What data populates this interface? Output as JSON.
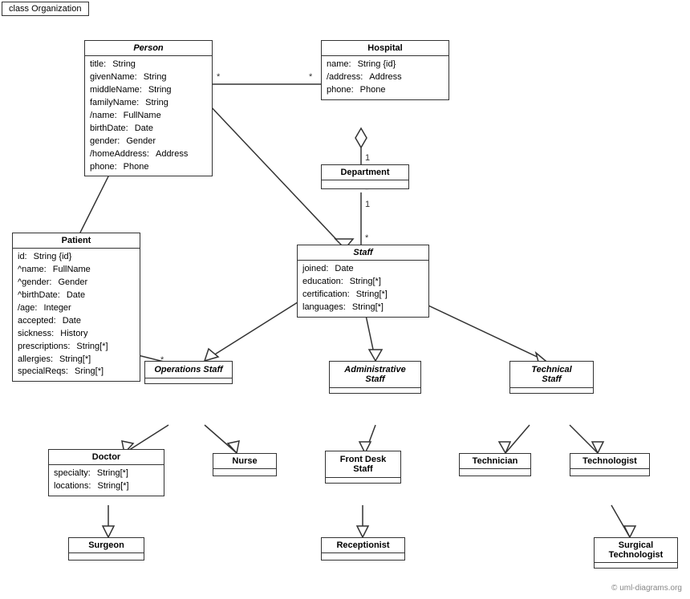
{
  "title": "class Organization",
  "watermark": "© uml-diagrams.org",
  "classes": {
    "person": {
      "name": "Person",
      "italic": true,
      "attrs": [
        {
          "name": "title:",
          "type": "String"
        },
        {
          "name": "givenName:",
          "type": "String"
        },
        {
          "name": "middleName:",
          "type": "String"
        },
        {
          "name": "familyName:",
          "type": "String"
        },
        {
          "name": "/name:",
          "type": "FullName"
        },
        {
          "name": "birthDate:",
          "type": "Date"
        },
        {
          "name": "gender:",
          "type": "Gender"
        },
        {
          "name": "/homeAddress:",
          "type": "Address"
        },
        {
          "name": "phone:",
          "type": "Phone"
        }
      ]
    },
    "hospital": {
      "name": "Hospital",
      "italic": false,
      "attrs": [
        {
          "name": "name:",
          "type": "String {id}"
        },
        {
          "name": "/address:",
          "type": "Address"
        },
        {
          "name": "phone:",
          "type": "Phone"
        }
      ]
    },
    "department": {
      "name": "Department",
      "italic": false,
      "attrs": []
    },
    "staff": {
      "name": "Staff",
      "italic": true,
      "attrs": [
        {
          "name": "joined:",
          "type": "Date"
        },
        {
          "name": "education:",
          "type": "String[*]"
        },
        {
          "name": "certification:",
          "type": "String[*]"
        },
        {
          "name": "languages:",
          "type": "String[*]"
        }
      ]
    },
    "patient": {
      "name": "Patient",
      "italic": false,
      "attrs": [
        {
          "name": "id:",
          "type": "String {id}"
        },
        {
          "name": "^name:",
          "type": "FullName"
        },
        {
          "name": "^gender:",
          "type": "Gender"
        },
        {
          "name": "^birthDate:",
          "type": "Date"
        },
        {
          "name": "/age:",
          "type": "Integer"
        },
        {
          "name": "accepted:",
          "type": "Date"
        },
        {
          "name": "sickness:",
          "type": "History"
        },
        {
          "name": "prescriptions:",
          "type": "String[*]"
        },
        {
          "name": "allergies:",
          "type": "String[*]"
        },
        {
          "name": "specialReqs:",
          "type": "Sring[*]"
        }
      ]
    },
    "operations_staff": {
      "name": "Operations Staff",
      "italic": true
    },
    "admin_staff": {
      "name": "Administrative Staff",
      "italic": true
    },
    "technical_staff": {
      "name": "Technical Staff",
      "italic": true
    },
    "doctor": {
      "name": "Doctor",
      "italic": false,
      "attrs": [
        {
          "name": "specialty:",
          "type": "String[*]"
        },
        {
          "name": "locations:",
          "type": "String[*]"
        }
      ]
    },
    "nurse": {
      "name": "Nurse",
      "italic": false,
      "attrs": []
    },
    "front_desk": {
      "name": "Front Desk Staff",
      "italic": false,
      "attrs": []
    },
    "technician": {
      "name": "Technician",
      "italic": false,
      "attrs": []
    },
    "technologist": {
      "name": "Technologist",
      "italic": false,
      "attrs": []
    },
    "surgeon": {
      "name": "Surgeon",
      "italic": false,
      "attrs": []
    },
    "receptionist": {
      "name": "Receptionist",
      "italic": false,
      "attrs": []
    },
    "surgical_technologist": {
      "name": "Surgical Technologist",
      "italic": false,
      "attrs": []
    }
  }
}
